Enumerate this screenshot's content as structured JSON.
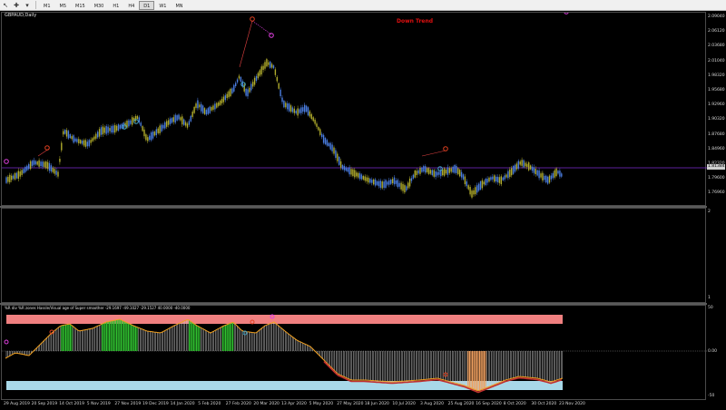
{
  "toolbar": {
    "cursor_icon": "cursor-icon",
    "crosshair_icon": "crosshair-icon",
    "timeframes": [
      "M1",
      "M5",
      "M15",
      "M30",
      "H1",
      "H4",
      "D1",
      "W1",
      "MN"
    ],
    "active_timeframe": "D1"
  },
  "main_chart": {
    "symbol_label": "GBPAUD,Daily",
    "trend_text": "Down Trend",
    "current_price": "1.81384",
    "price_labels": [
      "2.09040",
      "2.06120",
      "2.03680",
      "2.01040",
      "1.98320",
      "1.95680",
      "1.92960",
      "1.90320",
      "1.87680",
      "1.84960",
      "1.82320",
      "1.79600",
      "1.76960"
    ],
    "colors": {
      "bull": "#4a7de0",
      "bear": "#b0ac2c",
      "hline": "#7a2ad0",
      "up_marker": "#e04020",
      "down_marker": "#40a0c0",
      "peak_marker": "#e040e0"
    }
  },
  "empty_panel": {
    "scale_labels": [
      "2",
      "1"
    ]
  },
  "oscillator": {
    "label": "%R div %R zones  Hassle/Visual age of Super smoother -29.1697 -49.1027 -29.1527 40.0000 -40.0000",
    "scale_labels": [
      "50",
      "0.00",
      "-50"
    ],
    "colors": {
      "upper_zone": "#f08080",
      "lower_zone": "#a8d8e8",
      "line": "#f0a020",
      "green_bars": "#30c030",
      "gray_bars": "#c8c8c8",
      "red_line": "#c03030",
      "orange_bars": "#f0a060"
    }
  },
  "time_axis": [
    "29 Aug 2019",
    "20 Sep 2019",
    "14 Oct 2019",
    "5 Nov 2019",
    "27 Nov 2019",
    "19 Dec 2019",
    "14 Jan 2020",
    "5 Feb 2020",
    "27 Feb 2020",
    "20 Mar 2020",
    "13 Apr 2020",
    "5 May 2020",
    "27 May 2020",
    "18 Jun 2020",
    "10 Jul 2020",
    "3 Aug 2020",
    "25 Aug 2020",
    "16 Sep 2020",
    "8 Oct 2020",
    "30 Oct 2020",
    "23 Nov 2020"
  ]
}
